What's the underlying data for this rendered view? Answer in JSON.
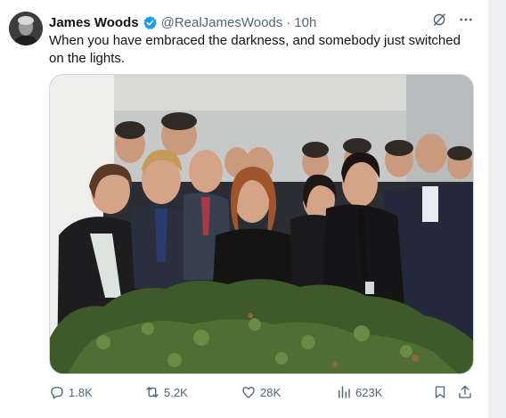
{
  "tweet": {
    "author_name": "James Woods",
    "handle": "@RealJamesWoods",
    "separator": "·",
    "time": "10h",
    "text": "When you have embraced the darkness, and somebody just switched on the lights."
  },
  "icons": {
    "verified": "verified-badge-icon",
    "grok": "grok-icon",
    "more": "more-icon",
    "reply": "reply-icon",
    "retweet": "retweet-icon",
    "like": "like-icon",
    "views": "views-icon",
    "bookmark": "bookmark-icon",
    "share": "share-icon"
  },
  "metrics": {
    "replies": "1.8K",
    "retweets": "5.2K",
    "likes": "28K",
    "views": "623K"
  },
  "colors": {
    "verified_blue": "#1d9bf0",
    "secondary_text": "#536471",
    "primary_text": "#0f1419"
  }
}
